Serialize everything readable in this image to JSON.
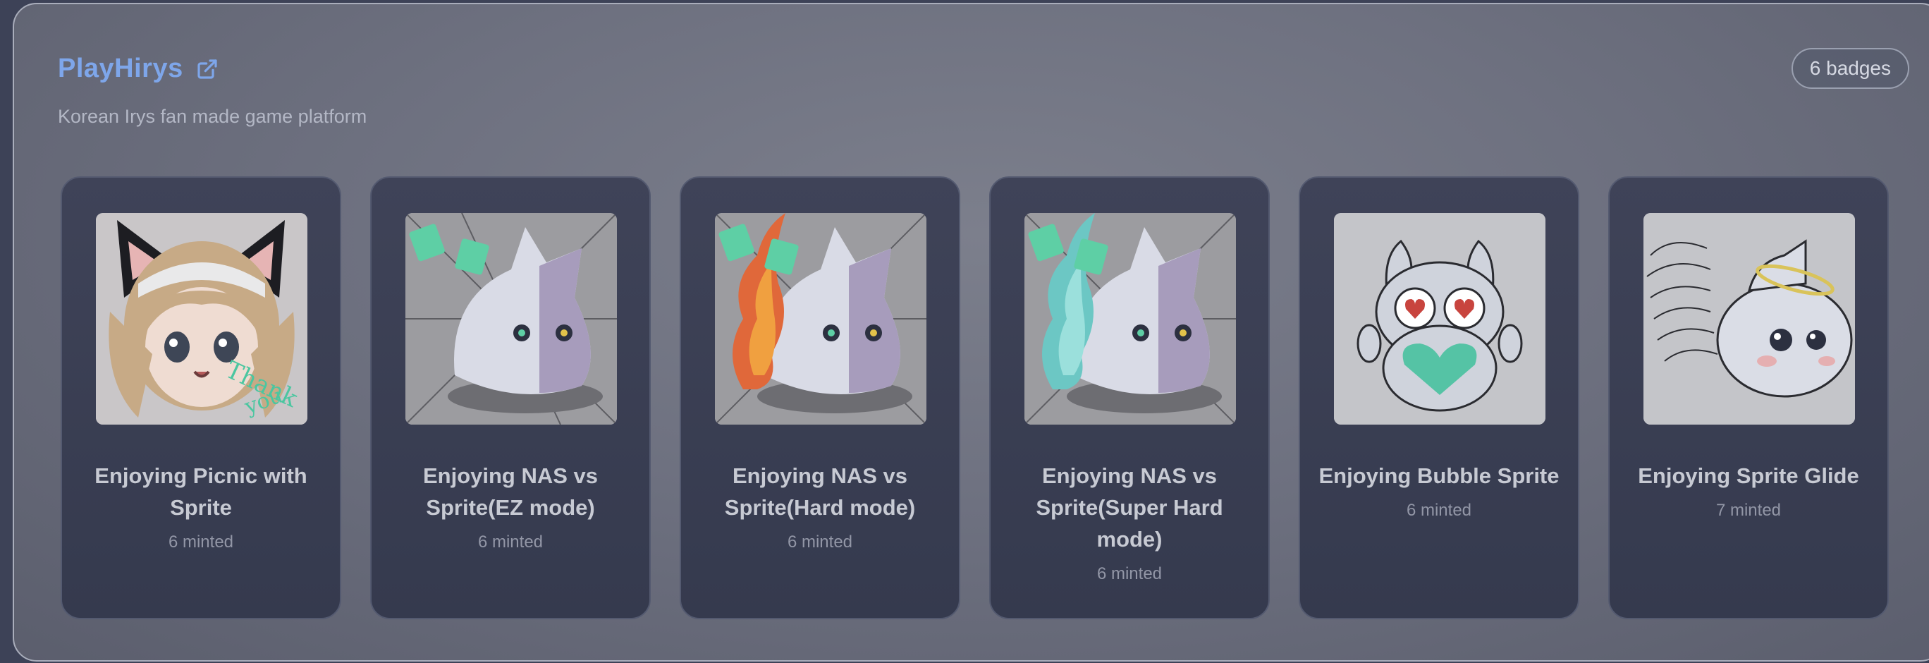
{
  "project": {
    "title": "PlayHirys",
    "subtitle": "Korean Irys fan made game platform",
    "badge_count_label": "6 badges",
    "accent_color": "#7ea6ea",
    "external_link_icon": "external-link-icon"
  },
  "badges": [
    {
      "name": "Enjoying Picnic with Sprite",
      "minted": "6 minted",
      "art": "maid-cat-girl"
    },
    {
      "name": "Enjoying NAS vs Sprite(EZ mode)",
      "minted": "6 minted",
      "art": "sprite-blob-burst"
    },
    {
      "name": "Enjoying NAS vs Sprite(Hard mode)",
      "minted": "6 minted",
      "art": "sprite-blob-fire"
    },
    {
      "name": "Enjoying NAS vs Sprite(Super Hard mode)",
      "minted": "6 minted",
      "art": "sprite-blob-ice"
    },
    {
      "name": "Enjoying Bubble Sprite",
      "minted": "6 minted",
      "art": "heart-eyes-sprite"
    },
    {
      "name": "Enjoying Sprite Glide",
      "minted": "7 minted",
      "art": "angel-sprite"
    }
  ]
}
